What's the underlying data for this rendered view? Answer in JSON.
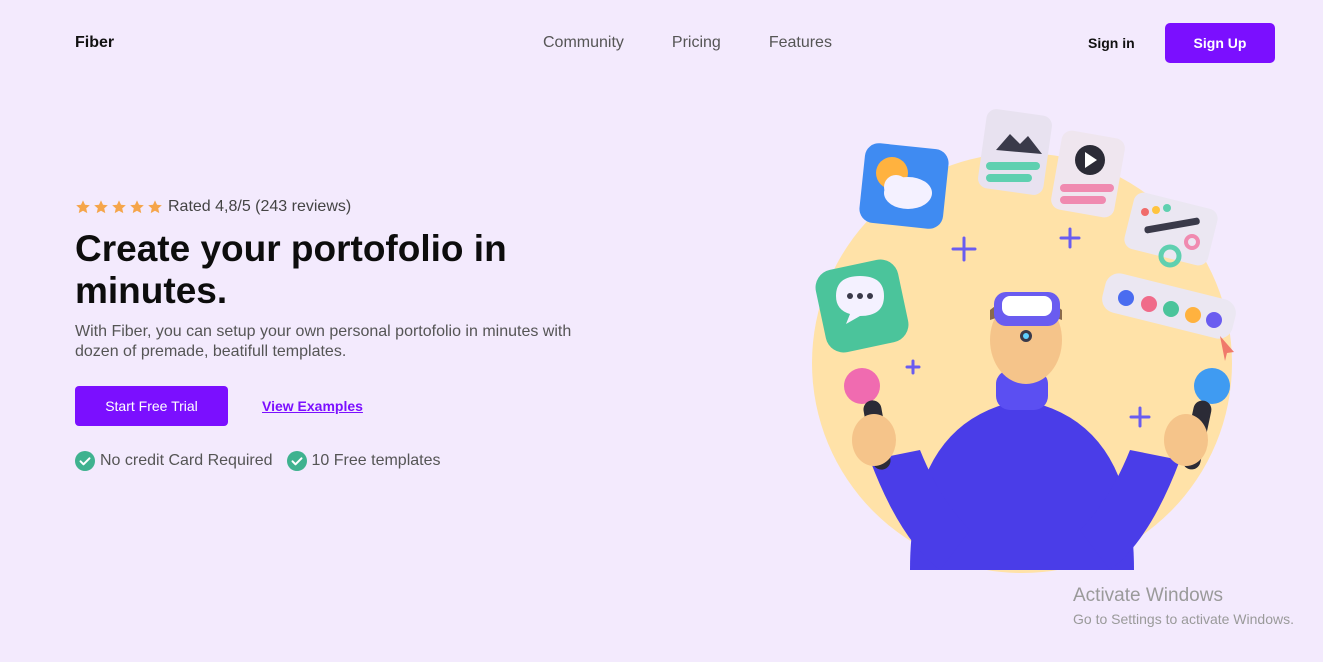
{
  "nav": {
    "logo": "Fiber",
    "links": [
      "Community",
      "Pricing",
      "Features"
    ],
    "signin": "Sign in",
    "signup": "Sign Up"
  },
  "hero": {
    "stars": 5,
    "rating_text": "Rated 4,8/5 (243 reviews)",
    "headline": "Create your portofolio in minutes.",
    "subtext": "With Fiber, you can setup your own personal portofolio in minutes with dozen of premade, beatifull templates.",
    "cta_primary": "Start Free Trial",
    "cta_secondary": "View Examples",
    "checks": [
      "No credit Card Required",
      "10 Free templates"
    ]
  },
  "colors": {
    "background": "#f3eafd",
    "accent": "#7b0fff",
    "star": "#f5a54a",
    "check": "#3fb28f",
    "sun_circle": "#ffe2a8",
    "figure": "#4a3de8"
  },
  "watermark": {
    "title": "Activate Windows",
    "subtitle": "Go to Settings to activate Windows."
  }
}
